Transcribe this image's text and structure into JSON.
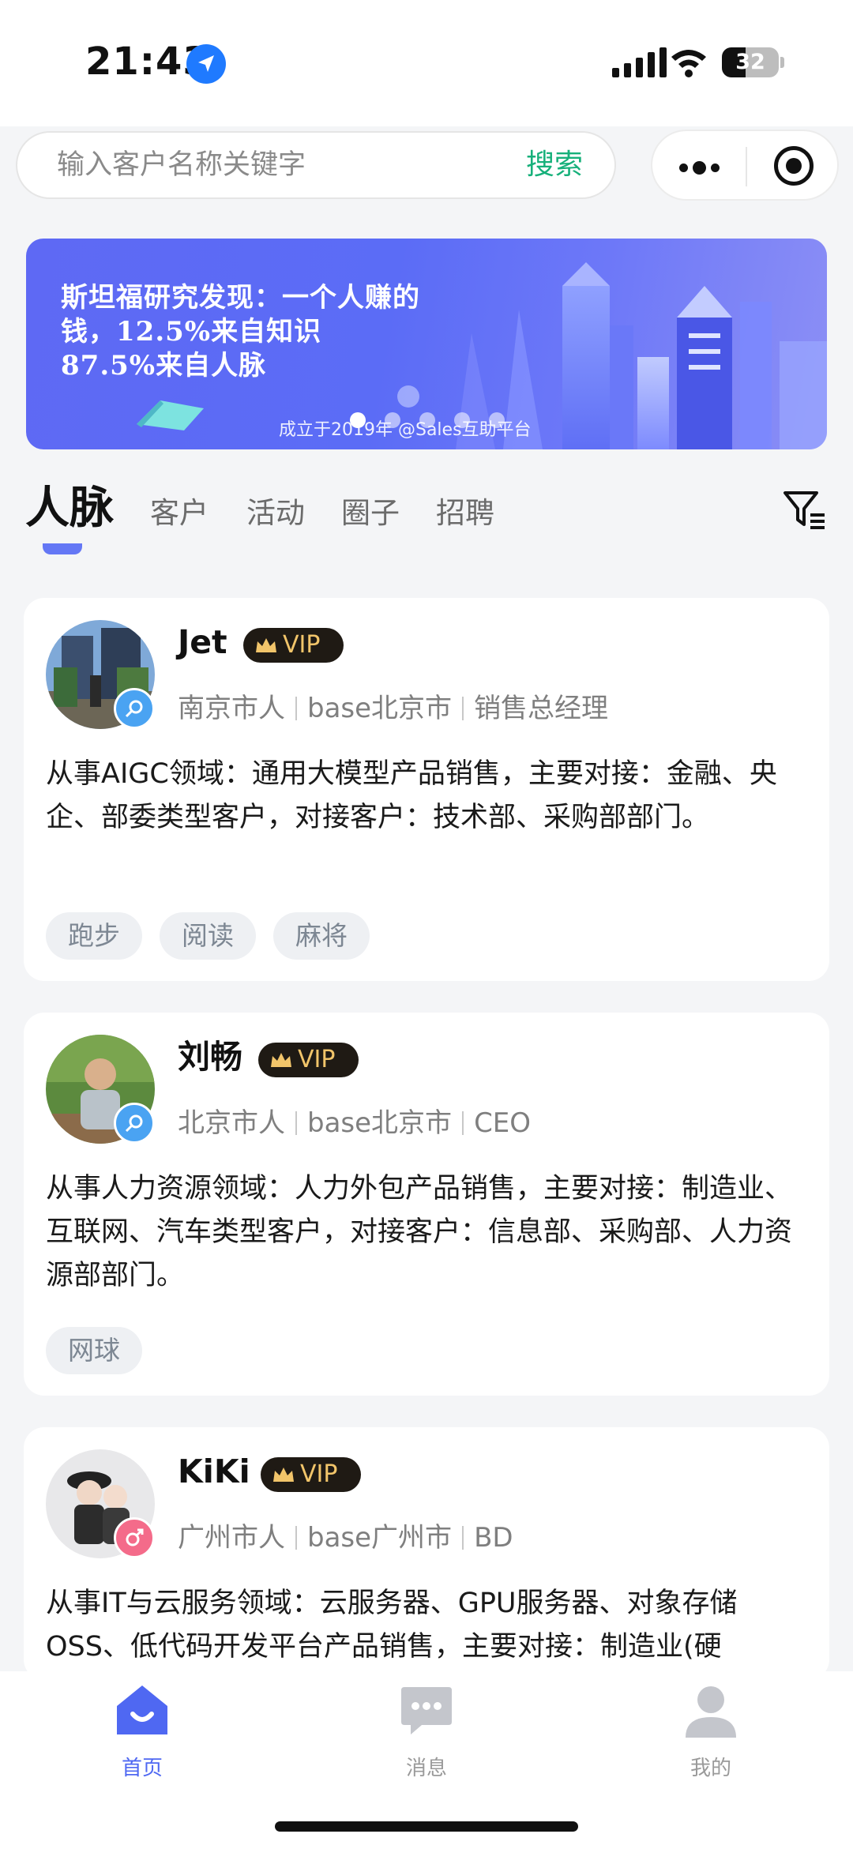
{
  "status": {
    "time": "21:43",
    "battery": "32"
  },
  "search": {
    "placeholder": "输入客户名称关键字",
    "button": "搜索"
  },
  "banner": {
    "headline_lines": [
      "斯坦福研究发现：一个人赚的",
      "钱，12.5%来自知识",
      "87.5%来自人脉"
    ],
    "footer": "成立于2019年 @Sales互助平台",
    "slide_count": 5,
    "active_slide": 1
  },
  "tabs": [
    "人脉",
    "客户",
    "活动",
    "圈子",
    "招聘"
  ],
  "active_tab": "人脉",
  "cards": [
    {
      "name": "Jet",
      "vip": "VIP",
      "gender": "male",
      "hometown": "南京市人",
      "base": "base北京市",
      "title": "销售总经理",
      "description": "从事AIGC领域：通用大模型产品销售，主要对接：金融、央企、部委类型客户，对接客户：技术部、采购部部门。",
      "tags": [
        "跑步",
        "阅读",
        "麻将"
      ]
    },
    {
      "name": "刘畅",
      "vip": "VIP",
      "gender": "male",
      "hometown": "北京市人",
      "base": "base北京市",
      "title": "CEO",
      "description": "从事人力资源领域：人力外包产品销售，主要对接：制造业、互联网、汽车类型客户，对接客户：信息部、采购部、人力资源部部门。",
      "tags": [
        "网球"
      ]
    },
    {
      "name": "KiKi",
      "vip": "VIP",
      "gender": "female",
      "hometown": "广州市人",
      "base": "base广州市",
      "title": "BD",
      "description": "从事IT与云服务领域：云服务器、GPU服务器、对象存储OSS、低代码开发平台产品销售，主要对接：制造业(硬",
      "tags": []
    }
  ],
  "tabbar": [
    {
      "label": "首页",
      "icon": "home-icon",
      "active": true
    },
    {
      "label": "消息",
      "icon": "message-icon",
      "active": false
    },
    {
      "label": "我的",
      "icon": "profile-icon",
      "active": false
    }
  ],
  "colors": {
    "accent": "#4f68f2",
    "search_green": "#16b07a",
    "vip_gold": "#f2c56a",
    "male": "#4aa3f2",
    "female": "#f46b8a"
  }
}
